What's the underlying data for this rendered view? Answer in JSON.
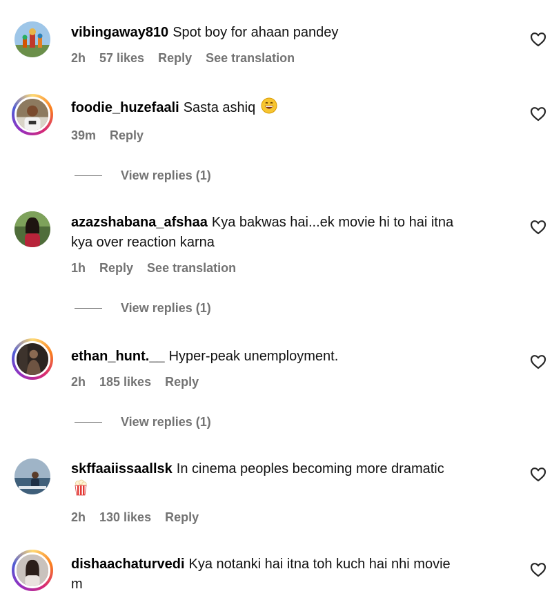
{
  "comments": [
    {
      "username": "vibingaway810",
      "text": "Spot boy for ahaan pandey",
      "time": "2h",
      "likes": "57 likes",
      "reply": "Reply",
      "translation": "See translation"
    },
    {
      "username": "foodie_huzefaali",
      "text": "Sasta ashiq",
      "time": "39m",
      "reply": "Reply",
      "view_replies": "View replies (1)"
    },
    {
      "username": "azazshabana_afshaa",
      "text_line1": "Kya bakwas hai...ek movie hi to hai itna",
      "text_line2": "kya over reaction karna",
      "time": "1h",
      "reply": "Reply",
      "translation": "See translation",
      "view_replies": "View replies (1)"
    },
    {
      "username": "ethan_hunt.__",
      "text": "Hyper-peak unemployment.",
      "time": "2h",
      "likes": "185 likes",
      "reply": "Reply",
      "view_replies": "View replies (1)"
    },
    {
      "username": "skffaaiissaallsk",
      "text": "In cinema peoples becoming more dramatic",
      "time": "2h",
      "likes": "130 likes",
      "reply": "Reply"
    },
    {
      "username": "dishaachaturvedi",
      "text_line1": "Kya notanki hai itna toh kuch hai nhi movie",
      "text_line2": "m"
    }
  ]
}
